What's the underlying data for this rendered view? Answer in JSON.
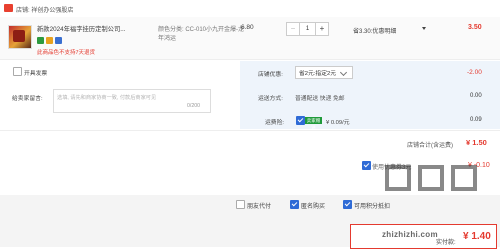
{
  "store": {
    "icon": "store-icon",
    "name": "店铺: 祥创办公强股店"
  },
  "item": {
    "title": "新款2024年福字挂历定制公司...",
    "badges": [
      "verified-badge",
      "gold-badge",
      "member-badge"
    ],
    "return_note": "此商品色不支持7天退货",
    "spec_line1": "颜色分类: CC-010小九开金爆-龙",
    "spec_line2": "年鸿运",
    "unit_price": "6.80",
    "quantity": "1",
    "promo": "省3.30:优惠明细",
    "subtotal": "3.50"
  },
  "invoice": {
    "label": "开具发票",
    "checked": false
  },
  "message": {
    "label": "给卖家留言:",
    "placeholder": "选填, 请先和商家协商一致, 付款后商家可见",
    "count": "0/200"
  },
  "shop_coupon": {
    "label": "店铺优惠:",
    "selected": "省2元:指定2元",
    "amount": "-2.00"
  },
  "shipping": {
    "label": "运送方式:",
    "method": "普通配送 快递 免邮",
    "amount": "0.00"
  },
  "insurance": {
    "label": "运费险:",
    "tag": "卖家赠送",
    "value": "¥ 0.09/元",
    "amount": "0.09"
  },
  "shop_total": {
    "label": "店铺合计(含运费)",
    "value": "¥ 1.50"
  },
  "platform_coupon": {
    "label": "使用优惠券3元",
    "value": "¥ -0.10",
    "checked": true
  },
  "options": [
    {
      "label": "朋友代付",
      "checked": false
    },
    {
      "label": "匿名购买",
      "checked": true
    },
    {
      "label": "可用积分抵扣",
      "checked": true
    }
  ],
  "payment": {
    "label": "实付款:",
    "value": "¥ 1.40"
  },
  "watermark": {
    "text": "zhizhizhi.com"
  }
}
